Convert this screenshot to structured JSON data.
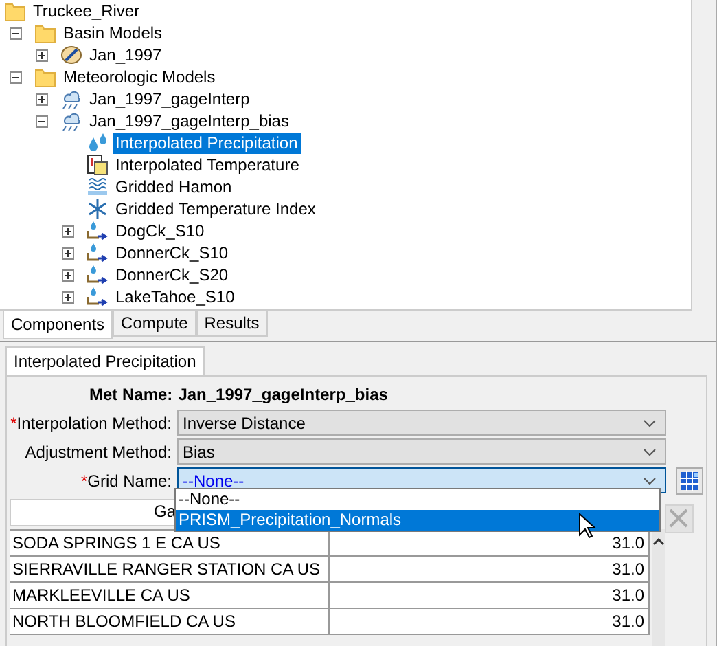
{
  "tree": {
    "items": [
      {
        "label": "Truckee_River",
        "kind": "folder",
        "selected": false,
        "children": [
          {
            "label": "Basin Models",
            "kind": "folder",
            "selected": false,
            "expanded": true,
            "children": [
              {
                "label": "Jan_1997",
                "kind": "basin",
                "selected": false,
                "expanded": false
              }
            ]
          },
          {
            "label": "Meteorologic Models",
            "kind": "folder",
            "selected": false,
            "expanded": true,
            "children": [
              {
                "label": "Jan_1997_gageInterp",
                "kind": "met",
                "selected": false,
                "expanded": false
              },
              {
                "label": "Jan_1997_gageInterp_bias",
                "kind": "met",
                "selected": false,
                "expanded": true,
                "children": [
                  {
                    "label": "Interpolated Precipitation",
                    "kind": "precip",
                    "selected": true
                  },
                  {
                    "label": "Interpolated Temperature",
                    "kind": "temperature",
                    "selected": false
                  },
                  {
                    "label": "Gridded Hamon",
                    "kind": "hamon",
                    "selected": false
                  },
                  {
                    "label": "Gridded Temperature Index",
                    "kind": "snow",
                    "selected": false
                  },
                  {
                    "label": "DogCk_S10",
                    "kind": "subbasin",
                    "selected": false,
                    "expanded": false
                  },
                  {
                    "label": "DonnerCk_S10",
                    "kind": "subbasin",
                    "selected": false,
                    "expanded": false
                  },
                  {
                    "label": "DonnerCk_S20",
                    "kind": "subbasin",
                    "selected": false,
                    "expanded": false
                  },
                  {
                    "label": "LakeTahoe_S10",
                    "kind": "subbasin",
                    "selected": false,
                    "expanded": false
                  }
                ]
              }
            ]
          }
        ]
      }
    ]
  },
  "tree_tabs": [
    {
      "label": "Components",
      "selected": true
    },
    {
      "label": "Compute",
      "selected": false
    },
    {
      "label": "Results",
      "selected": false
    }
  ],
  "editor": {
    "tab": {
      "label": "Interpolated Precipitation",
      "selected": true
    },
    "met_name": {
      "label": "Met Name:",
      "value": "Jan_1997_gageInterp_bias"
    },
    "fields": [
      {
        "marker": "*",
        "label": "Interpolation Method:",
        "value": "Inverse Distance",
        "focused": false
      },
      {
        "label": "Adjustment Method:",
        "value": "Bias",
        "focused": false
      },
      {
        "marker": "*",
        "label": "Grid Name:",
        "value": "--None--",
        "focused": true
      }
    ],
    "dropdown": {
      "options": [
        {
          "label": "--None--",
          "selected": false
        },
        {
          "label": "PRISM_Precipitation_Normals",
          "selected": true
        }
      ]
    },
    "remove_button": {
      "disabled": true
    },
    "table": {
      "columns": [
        {
          "header": "Ga"
        }
      ],
      "rows": [
        {
          "column_1": "SODA SPRINGS 1 E CA US",
          "column_2": "31.0"
        },
        {
          "column_1": "SIERRAVILLE RANGER STATION CA US",
          "column_2": "31.0"
        },
        {
          "column_1": "MARKLEEVILLE CA US",
          "column_2": "31.0"
        },
        {
          "column_1": "NORTH BLOOMFIELD CA US",
          "column_2": "31.0"
        }
      ]
    }
  }
}
